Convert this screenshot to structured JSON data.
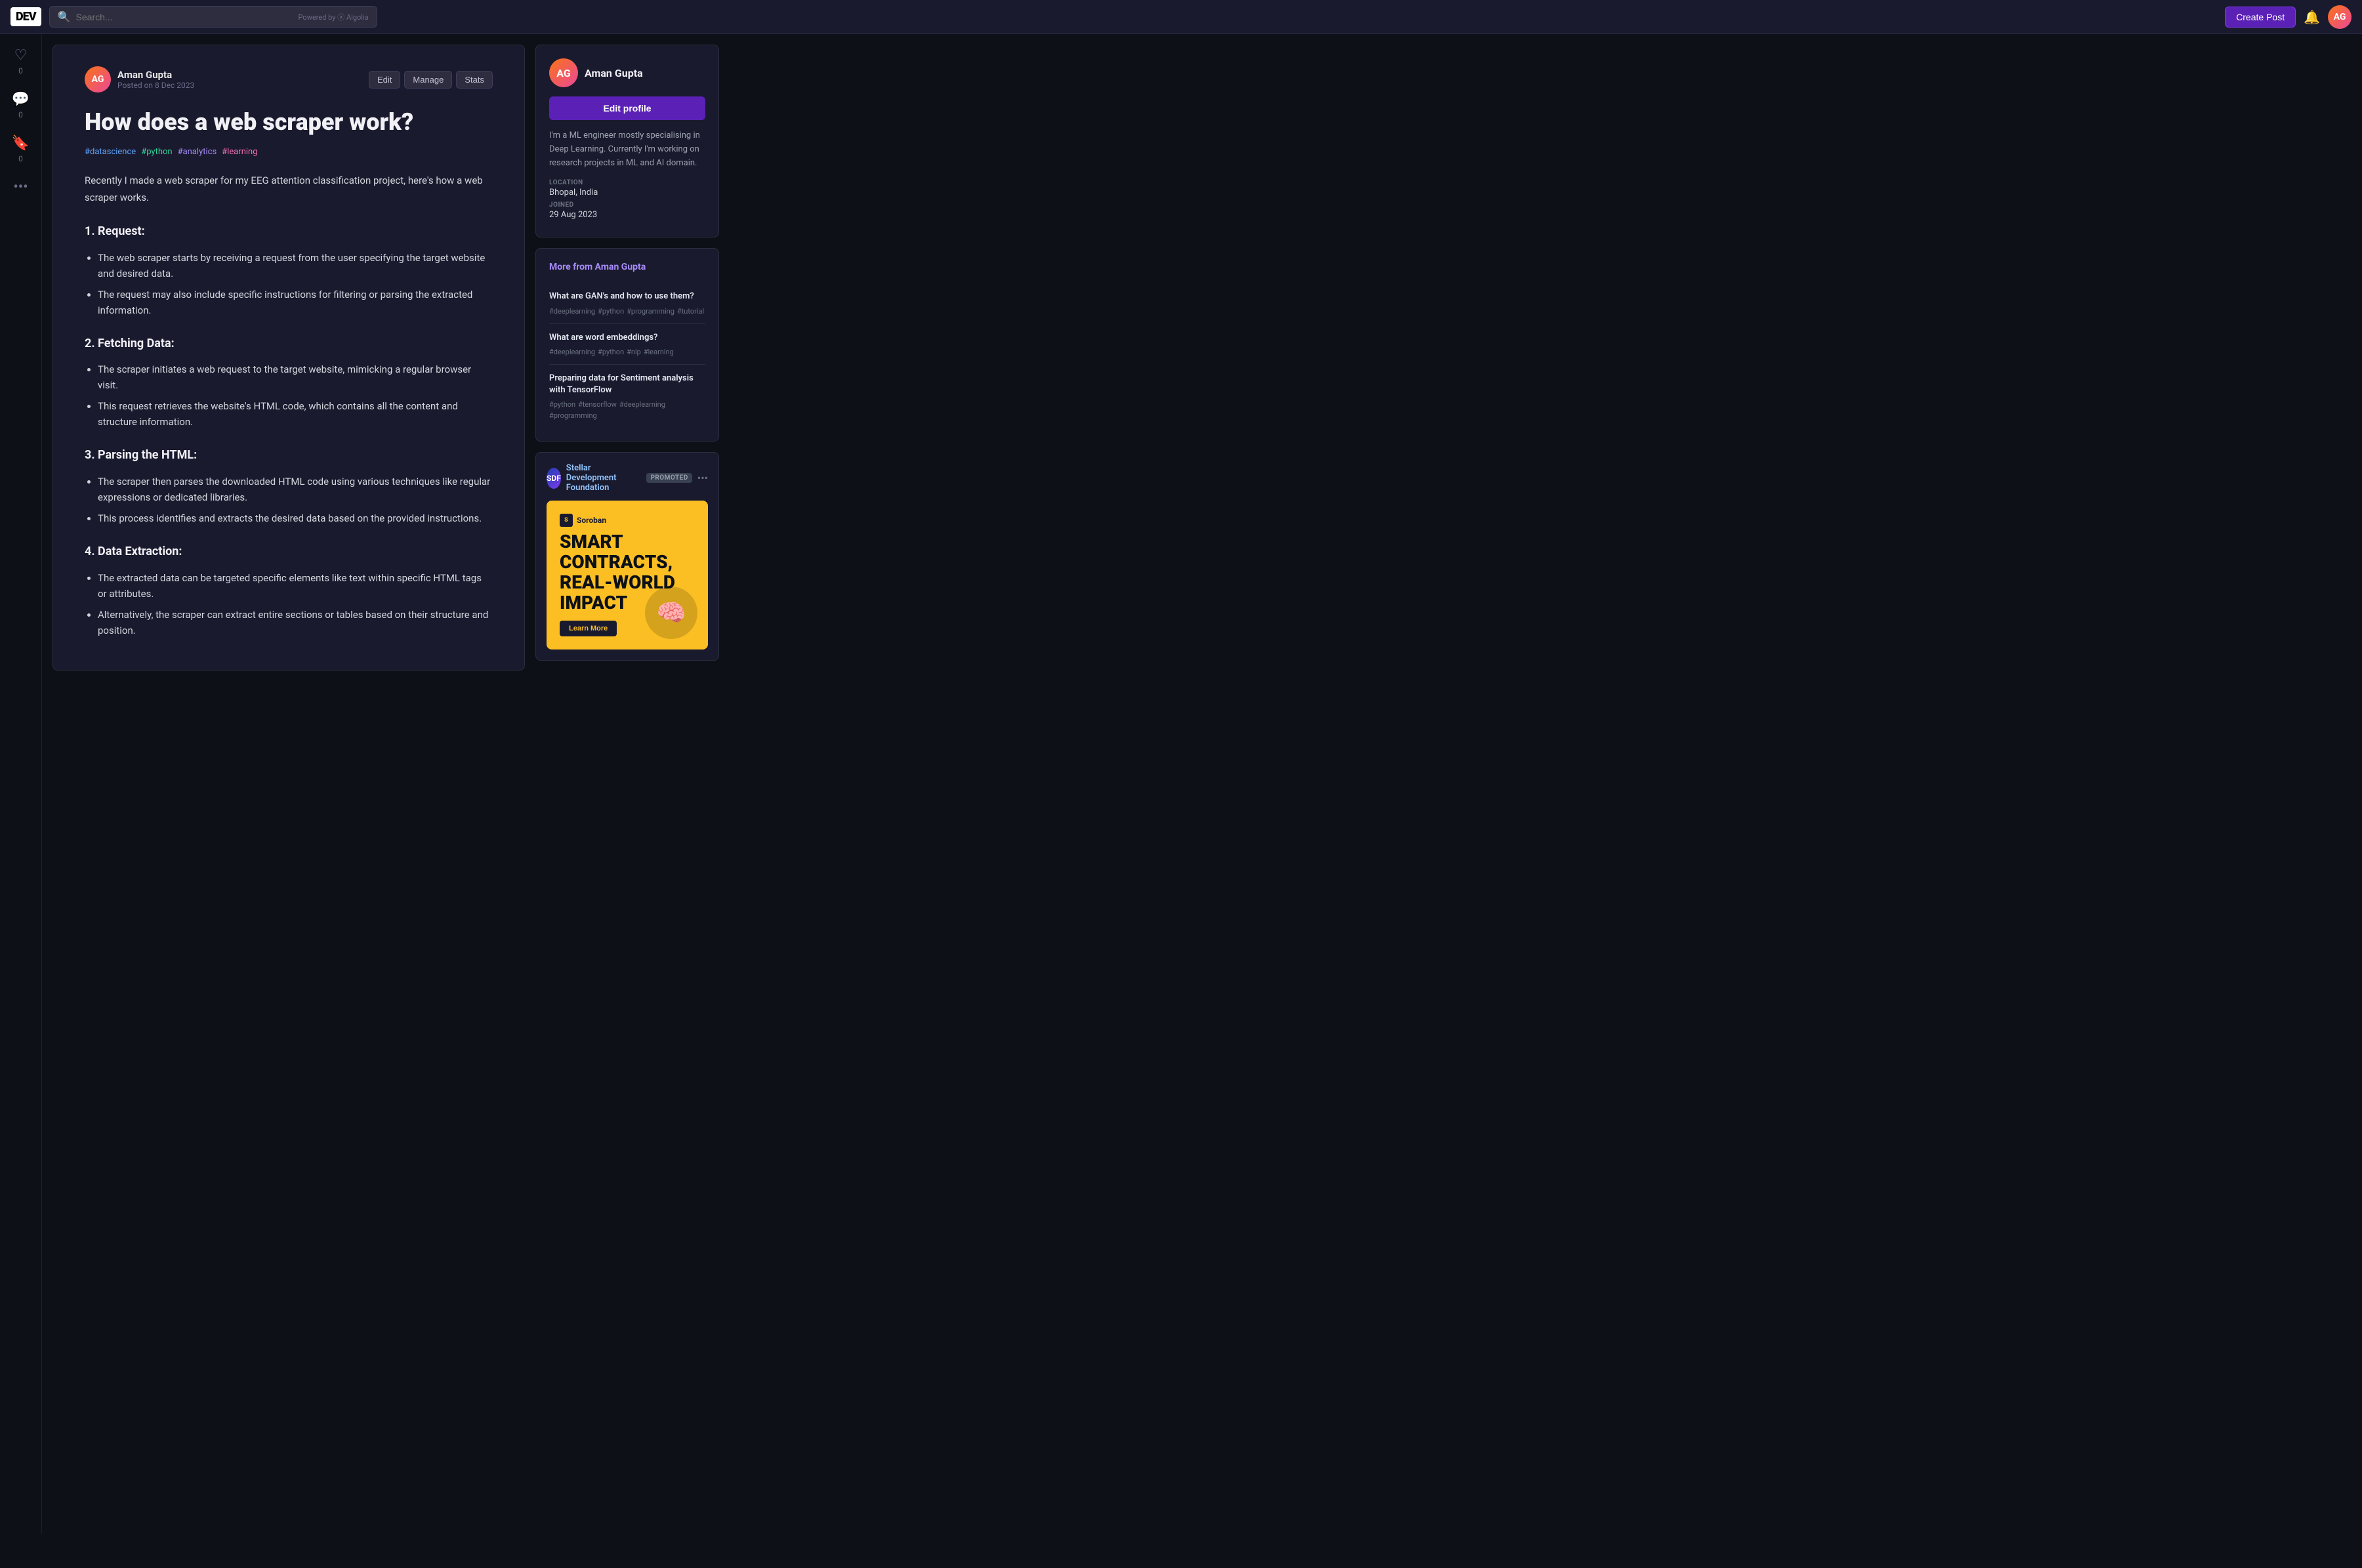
{
  "nav": {
    "logo": "DEV",
    "search_placeholder": "Search...",
    "powered_by": "Powered by",
    "algolia": "Algolia",
    "create_post_label": "Create Post"
  },
  "sidebar_left": {
    "heart_count": "0",
    "comment_count": "0",
    "bookmark_count": "0",
    "more_label": "..."
  },
  "article": {
    "author_name": "Aman Gupta",
    "posted_label": "Posted on 8 Dec 2023",
    "action_edit": "Edit",
    "action_manage": "Manage",
    "action_stats": "Stats",
    "title": "How does a web scraper work?",
    "tags": [
      {
        "label": "#datascience",
        "class": "datascience"
      },
      {
        "label": "#python",
        "class": "python"
      },
      {
        "label": "#analytics",
        "class": "analytics"
      },
      {
        "label": "#learning",
        "class": "learning"
      }
    ],
    "intro": "Recently I made a web scraper for my EEG attention classification project, here's how a web scraper works.",
    "sections": [
      {
        "heading": "1. Request:",
        "bullets": [
          "The web scraper starts by receiving a request from the user specifying the target website and desired data.",
          "The request may also include specific instructions for filtering or parsing the extracted information."
        ]
      },
      {
        "heading": "2. Fetching Data:",
        "bullets": [
          "The scraper initiates a web request to the target website, mimicking a regular browser visit.",
          "This request retrieves the website's HTML code, which contains all the content and structure information."
        ]
      },
      {
        "heading": "3. Parsing the HTML:",
        "bullets": [
          "The scraper then parses the downloaded HTML code using various techniques like regular expressions or dedicated libraries.",
          "This process identifies and extracts the desired data based on the provided instructions."
        ]
      },
      {
        "heading": "4. Data Extraction:",
        "bullets": [
          "The extracted data can be targeted specific elements like text within specific HTML tags or attributes.",
          "Alternatively, the scraper can extract entire sections or tables based on their structure and position."
        ]
      }
    ]
  },
  "profile": {
    "name": "Aman Gupta",
    "edit_profile_label": "Edit profile",
    "bio": "I'm a ML engineer mostly specialising in Deep Learning. Currently I'm working on research projects in ML and AI domain.",
    "location_label": "LOCATION",
    "location": "Bhopal, India",
    "joined_label": "JOINED",
    "joined": "29 Aug 2023"
  },
  "more_from": {
    "prefix": "More from",
    "author": "Aman Gupta",
    "posts": [
      {
        "title": "What are GAN's and how to use them?",
        "tags": [
          "#deeplearning",
          "#python",
          "#programming",
          "#tutorial"
        ]
      },
      {
        "title": "What are word embeddings?",
        "tags": [
          "#deeplearning",
          "#python",
          "#nlp",
          "#learning"
        ]
      },
      {
        "title": "Preparing data for Sentiment analysis with TensorFlow",
        "tags": [
          "#python",
          "#tensorflow",
          "#deeplearning",
          "#programming"
        ]
      }
    ]
  },
  "promoted": {
    "org_name": "Stellar Development Foundation",
    "badge": "PROMOTED",
    "ad_brand": "Soroban",
    "ad_title": "SMART CONTRACTS, REAL-WORLD IMPACT",
    "ad_learn_more": "Learn More"
  }
}
